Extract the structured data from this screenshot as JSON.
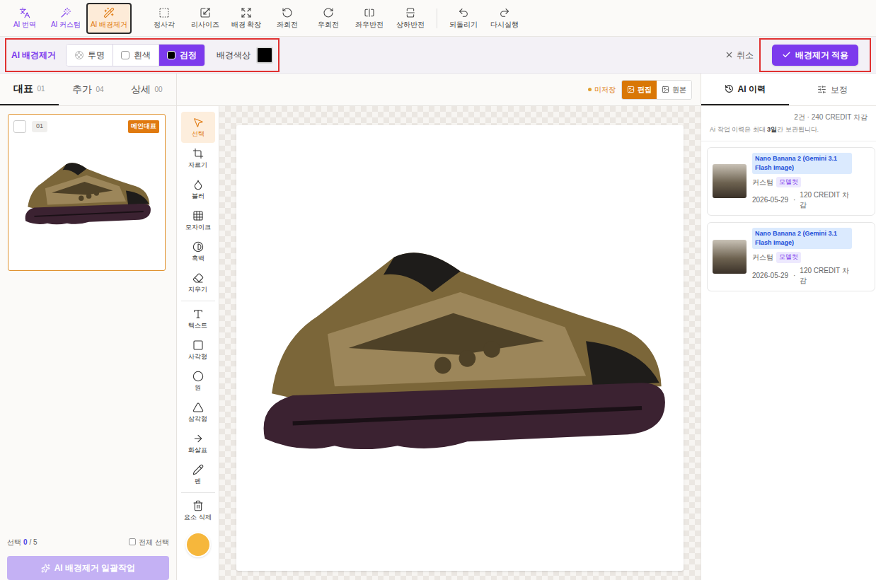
{
  "toolbar": {
    "items": [
      {
        "label": "AI 번역",
        "kind": "ai",
        "selected": false
      },
      {
        "label": "AI 커스텀",
        "kind": "ai",
        "selected": false
      },
      {
        "label": "AI 배경제거",
        "kind": "ai",
        "selected": true
      },
      {
        "label": "정사각",
        "kind": "tool",
        "selected": false
      },
      {
        "label": "리사이즈",
        "kind": "tool",
        "selected": false
      },
      {
        "label": "배경 확장",
        "kind": "tool",
        "selected": false
      },
      {
        "label": "좌회전",
        "kind": "tool",
        "selected": false
      },
      {
        "label": "우회전",
        "kind": "tool",
        "selected": false
      },
      {
        "label": "좌우반전",
        "kind": "tool",
        "selected": false
      },
      {
        "label": "상하반전",
        "kind": "tool",
        "selected": false
      },
      {
        "label": "되돌리기",
        "kind": "history",
        "selected": false
      },
      {
        "label": "다시실행",
        "kind": "history",
        "selected": false
      }
    ]
  },
  "bg_removal_bar": {
    "title": "AI 배경제거",
    "options": [
      {
        "label": "투명",
        "selected": false
      },
      {
        "label": "흰색",
        "selected": false
      },
      {
        "label": "검정",
        "selected": true
      }
    ],
    "color_label": "배경색상",
    "color": "#000000",
    "cancel": "취소",
    "apply": "배경제거 적용"
  },
  "left_panel": {
    "tabs": [
      {
        "label": "대표",
        "count": "01",
        "selected": true
      },
      {
        "label": "추가",
        "count": "04",
        "selected": false
      },
      {
        "label": "상세",
        "count": "00",
        "selected": false
      }
    ],
    "images": [
      {
        "number": "01",
        "badge": "메인대표",
        "checked": false,
        "selected": true
      }
    ],
    "selection": {
      "label": "선택",
      "count": "0",
      "total": "/ 5"
    },
    "select_all": {
      "label": "전체 선택",
      "checked": false
    },
    "batch_button": {
      "label": "AI 배경제거 일괄작업",
      "disabled": true
    }
  },
  "editor": {
    "save_status": "미저장",
    "view_modes": [
      {
        "label": "편집",
        "selected": true
      },
      {
        "label": "원본",
        "selected": false
      }
    ],
    "tool_groups": [
      [
        {
          "label": "선택",
          "selected": true
        },
        {
          "label": "자르기",
          "selected": false
        },
        {
          "label": "블러",
          "selected": false
        },
        {
          "label": "모자이크",
          "selected": false
        },
        {
          "label": "흑백",
          "selected": false
        },
        {
          "label": "지우기",
          "selected": false
        }
      ],
      [
        {
          "label": "텍스트",
          "selected": false
        },
        {
          "label": "사각형",
          "selected": false
        },
        {
          "label": "원",
          "selected": false
        },
        {
          "label": "삼각형",
          "selected": false
        },
        {
          "label": "화살표",
          "selected": false
        },
        {
          "label": "펜",
          "selected": false
        }
      ],
      [
        {
          "label": "요소 삭제",
          "selected": false
        }
      ]
    ],
    "current_color": "#f6b73c"
  },
  "right_panel": {
    "tabs": [
      {
        "label": "AI 이력",
        "selected": true
      },
      {
        "label": "보정",
        "selected": false
      }
    ],
    "summary": "2건 · 240 CREDIT 차감",
    "notice": [
      {
        "text": "Ai 작업 이력은 최대 ",
        "bold": false
      },
      {
        "text": "3일",
        "bold": true
      },
      {
        "text": "간 보관됩니다.",
        "bold": false
      }
    ],
    "history": [
      {
        "model": "Nano Banana 2 (Gemini 3.1 Flash Image)",
        "type": "커스텀",
        "tag": "모델컷",
        "date": "2026-05-29",
        "separator": "·",
        "credits": "120 CREDIT 차감"
      },
      {
        "model": "Nano Banana 2 (Gemini 3.1 Flash Image)",
        "type": "커스텀",
        "tag": "모델컷",
        "date": "2026-05-29",
        "separator": "·",
        "credits": "120 CREDIT 차감"
      }
    ]
  }
}
